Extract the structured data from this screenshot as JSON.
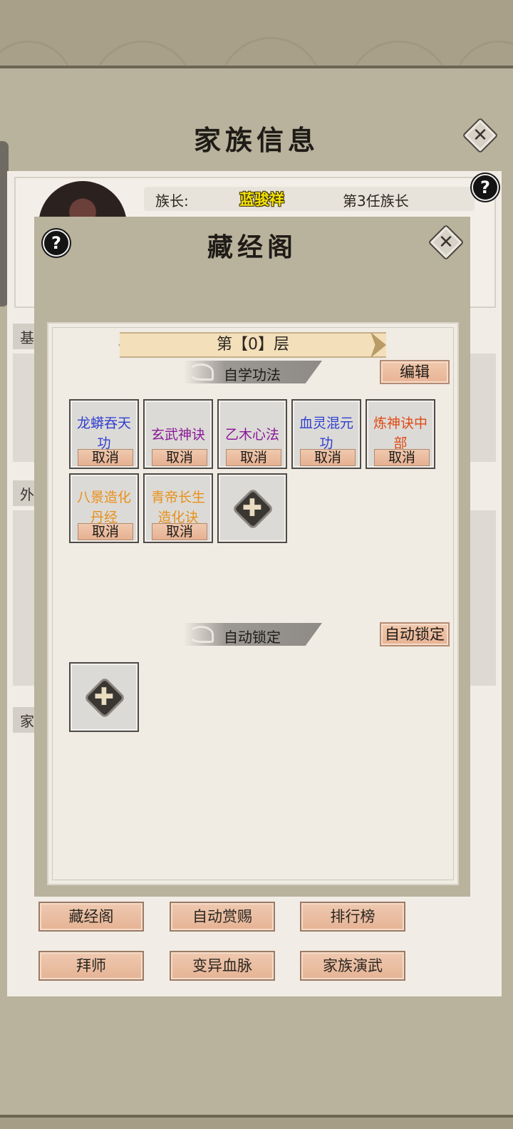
{
  "header": {
    "title": "家族信息",
    "close_icon": "close-icon",
    "help_icon": "help-icon"
  },
  "family": {
    "leader_label": "族长:",
    "leader_name": "蓝骏祥",
    "leader_generation": "第3任族长",
    "section_tabs": [
      "基",
      "外",
      "家"
    ]
  },
  "bottom_buttons": [
    "藏经阁",
    "自动赏赐",
    "排行榜",
    "拜师",
    "变异血脉",
    "家族演武"
  ],
  "pavilion": {
    "title": "藏经阁",
    "floor": "第【0】层",
    "self_study_title": "自学功法",
    "edit_label": "编辑",
    "techniques": [
      {
        "name": "龙蟒吞天功",
        "color": "#2f3fd0",
        "cancel": "取消"
      },
      {
        "name": "玄武神诀",
        "color": "#8a1a9a",
        "cancel": "取消"
      },
      {
        "name": "乙木心法",
        "color": "#8a1a9a",
        "cancel": "取消"
      },
      {
        "name": "血灵混元功",
        "color": "#2f3fd0",
        "cancel": "取消"
      },
      {
        "name": "炼神诀中部",
        "color": "#e04a14",
        "cancel": "取消"
      },
      {
        "name": "八景造化丹经",
        "color": "#e8901a",
        "cancel": "取消"
      },
      {
        "name": "青帝长生造化诀",
        "color": "#e8901a",
        "cancel": "取消"
      }
    ],
    "auto_lock_title": "自动锁定",
    "auto_lock_button": "自动锁定",
    "add_icon": "plus-icon"
  }
}
